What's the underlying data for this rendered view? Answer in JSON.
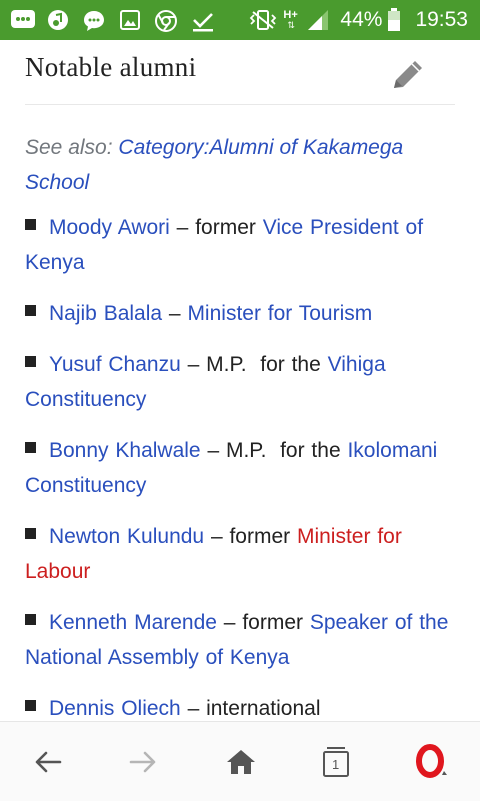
{
  "status_bar": {
    "network_type": "H+",
    "battery": "44%",
    "time": "19:53"
  },
  "section": {
    "title": "Notable alumni"
  },
  "see_also": {
    "prefix": "See also:",
    "link": "Category:Alumni of Kakamega School"
  },
  "alumni": [
    {
      "name": "Moody Awori",
      "sep": " – former ",
      "link1": "Vice President of Kenya"
    },
    {
      "name": "Najib Balala",
      "sep": " – ",
      "link1": "Minister for Tourism"
    },
    {
      "name": "Yusuf Chanzu",
      "sep": " – M.P.  for the ",
      "link1": "Vihiga Constituency"
    },
    {
      "name": "Bonny Khalwale",
      "sep": " – M.P.  for the ",
      "link1": "Ikolomani Constituency"
    },
    {
      "name": "Newton Kulundu",
      "sep": " – former ",
      "link1": "Minister for Labour"
    },
    {
      "name": "Kenneth Marende",
      "sep": " – former ",
      "link1": "Speaker of the National Assembly of Kenya"
    },
    {
      "name": "Dennis Oliech",
      "sep": " – international",
      "link1": ""
    }
  ],
  "bottom_nav": {
    "tab_count": "1"
  },
  "colors": {
    "status_bar": "#4a9b2e",
    "link": "#2a4fbd",
    "redlink": "#cc1f1f",
    "opera_red": "#e0161e"
  }
}
